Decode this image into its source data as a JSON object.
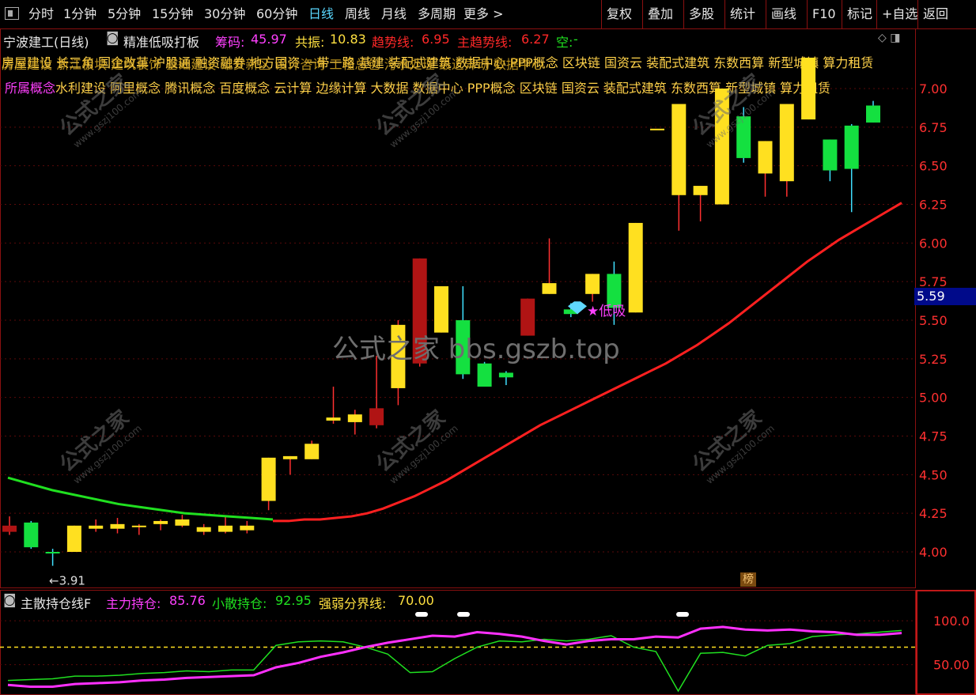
{
  "toolbar": {
    "periods": [
      "分时",
      "1分钟",
      "5分钟",
      "15分钟",
      "30分钟",
      "60分钟",
      "日线",
      "周线",
      "月线",
      "多周期",
      "更多 >"
    ],
    "active_period": "日线",
    "tools": [
      "复权",
      "叠加",
      "多股",
      "统计",
      "画线",
      "F10",
      "标记",
      "+自选",
      "返回"
    ]
  },
  "header": {
    "stock": "宁波建工(日线)",
    "indicator": "精准低吸打板",
    "chouma_label": "筹码:",
    "chouma_value": "45.97",
    "gongzhen_label": "共振:",
    "gongzhen_value": "10.83",
    "trend_label": "趋势线:",
    "trend_value": "6.95",
    "main_trend_label": "主趋势线:",
    "main_trend_value": "6.27",
    "kong_label": "空:",
    "kong_value": "-"
  },
  "concepts": {
    "label": "所属概念",
    "text": "水利建设 阿里概念 腾讯概念 百度概念 云计算 边缘计算 大数据 数据中心 PPP概念 区块链 国资云 装配式建筑 东数西算 新型城镇 算力租赁",
    "overlap_text": "房屋建设 长三角 国企改革 沪股通 融资融券 地方国资 一带一路 基建 装配式建筑 数据中心 PPP概念 区块链 国资云 装配式建筑 东数西算 新型城镇 算力租赁",
    "overlap_text2": "房屋建设 浙江板块 建筑装饰 基础建设 雄安新区 设计咨询 工程总包 污水处理 最近异动 数据中心"
  },
  "watermark": "公式之家 bbs.gszb.top",
  "watermark_small": "公式之家",
  "watermark_url": "www.gszj100.com",
  "price_tag": "5.59",
  "low_mark": "←3.91",
  "dixi_label": "低吸",
  "bang_label": "榜",
  "indicator_panel": {
    "title": "主散持仓线F",
    "main_label": "主力持仓:",
    "main_value": "85.76",
    "retail_label": "小散持仓:",
    "retail_value": "92.95",
    "boundary_label": "强弱分界线:",
    "boundary_value": "70.00",
    "y_ticks": [
      "100.0",
      "50.00"
    ]
  },
  "colors": {
    "up": "#ffe020",
    "up_dark": "#d4a000",
    "down": "#14e040",
    "down_red": "#b01414",
    "trend_red": "#ff2020",
    "trend_green": "#20e020",
    "magenta": "#ff30ff",
    "yellow": "#ffd24a",
    "grid": "#5a0a0a"
  },
  "chart_data": {
    "type": "candlestick",
    "ylim": [
      3.85,
      7.2
    ],
    "y_ticks": [
      "7.00",
      "6.75",
      "6.50",
      "6.25",
      "6.00",
      "5.75",
      "5.50",
      "5.25",
      "5.00",
      "4.75",
      "4.50",
      "4.25",
      "4.00"
    ],
    "candles": [
      {
        "o": 4.17,
        "h": 4.23,
        "l": 4.11,
        "c": 4.13,
        "dir": "down_red"
      },
      {
        "o": 4.19,
        "h": 4.2,
        "l": 4.02,
        "c": 4.03,
        "dir": "down"
      },
      {
        "o": 3.99,
        "h": 4.02,
        "l": 3.91,
        "c": 4.0,
        "dir": "down"
      },
      {
        "o": 4.0,
        "h": 4.17,
        "l": 4.0,
        "c": 4.17,
        "dir": "up"
      },
      {
        "o": 4.15,
        "h": 4.21,
        "l": 4.13,
        "c": 4.17,
        "dir": "up"
      },
      {
        "o": 4.15,
        "h": 4.22,
        "l": 4.12,
        "c": 4.18,
        "dir": "up"
      },
      {
        "o": 4.17,
        "h": 4.18,
        "l": 4.11,
        "c": 4.17,
        "dir": "up"
      },
      {
        "o": 4.18,
        "h": 4.21,
        "l": 4.14,
        "c": 4.2,
        "dir": "up"
      },
      {
        "o": 4.17,
        "h": 4.24,
        "l": 4.16,
        "c": 4.21,
        "dir": "up"
      },
      {
        "o": 4.13,
        "h": 4.18,
        "l": 4.11,
        "c": 4.16,
        "dir": "up"
      },
      {
        "o": 4.13,
        "h": 4.23,
        "l": 4.12,
        "c": 4.17,
        "dir": "up"
      },
      {
        "o": 4.14,
        "h": 4.2,
        "l": 4.12,
        "c": 4.17,
        "dir": "up"
      },
      {
        "o": 4.33,
        "h": 4.61,
        "l": 4.27,
        "c": 4.61,
        "dir": "up"
      },
      {
        "o": 4.6,
        "h": 4.62,
        "l": 4.5,
        "c": 4.62,
        "dir": "up"
      },
      {
        "o": 4.6,
        "h": 4.72,
        "l": 4.6,
        "c": 4.7,
        "dir": "up"
      },
      {
        "o": 4.85,
        "h": 5.07,
        "l": 4.83,
        "c": 4.87,
        "dir": "up"
      },
      {
        "o": 4.84,
        "h": 4.92,
        "l": 4.76,
        "c": 4.89,
        "dir": "up"
      },
      {
        "o": 4.93,
        "h": 5.27,
        "l": 4.8,
        "c": 4.82,
        "dir": "down_red"
      },
      {
        "o": 5.06,
        "h": 5.5,
        "l": 4.95,
        "c": 5.47,
        "dir": "up"
      },
      {
        "o": 5.9,
        "h": 5.9,
        "l": 5.2,
        "c": 5.22,
        "dir": "down_red"
      },
      {
        "o": 5.42,
        "h": 5.72,
        "l": 5.42,
        "c": 5.72,
        "dir": "up"
      },
      {
        "o": 5.5,
        "h": 5.72,
        "l": 5.12,
        "c": 5.15,
        "dir": "down"
      },
      {
        "o": 5.22,
        "h": 5.23,
        "l": 5.07,
        "c": 5.07,
        "dir": "down"
      },
      {
        "o": 5.16,
        "h": 5.17,
        "l": 5.08,
        "c": 5.13,
        "dir": "down"
      },
      {
        "o": 5.4,
        "h": 5.64,
        "l": 5.4,
        "c": 5.64,
        "dir": "down_red"
      },
      {
        "o": 5.67,
        "h": 6.03,
        "l": 5.67,
        "c": 5.74,
        "dir": "up"
      },
      {
        "o": 5.54,
        "h": 5.61,
        "l": 5.52,
        "c": 5.57,
        "dir": "down"
      },
      {
        "o": 5.67,
        "h": 5.8,
        "l": 5.62,
        "c": 5.8,
        "dir": "up"
      },
      {
        "o": 5.8,
        "h": 5.88,
        "l": 5.47,
        "c": 5.58,
        "dir": "down"
      },
      {
        "o": 5.55,
        "h": 6.13,
        "l": 5.55,
        "c": 6.13,
        "dir": "up"
      },
      {
        "o": 6.74,
        "h": 6.74,
        "l": 6.74,
        "c": 6.74,
        "dir": "up"
      },
      {
        "o": 6.31,
        "h": 6.9,
        "l": 6.08,
        "c": 6.9,
        "dir": "up"
      },
      {
        "o": 6.31,
        "h": 6.37,
        "l": 6.14,
        "c": 6.37,
        "dir": "up"
      },
      {
        "o": 6.25,
        "h": 7.0,
        "l": 6.25,
        "c": 7.0,
        "dir": "up"
      },
      {
        "o": 6.82,
        "h": 6.88,
        "l": 6.52,
        "c": 6.55,
        "dir": "down"
      },
      {
        "o": 6.45,
        "h": 6.66,
        "l": 6.3,
        "c": 6.66,
        "dir": "up"
      },
      {
        "o": 6.4,
        "h": 6.9,
        "l": 6.3,
        "c": 6.9,
        "dir": "up"
      },
      {
        "o": 6.8,
        "h": 7.2,
        "l": 6.8,
        "c": 7.2,
        "dir": "up"
      },
      {
        "o": 6.67,
        "h": 6.67,
        "l": 6.4,
        "c": 6.47,
        "dir": "down"
      },
      {
        "o": 6.48,
        "h": 6.77,
        "l": 6.2,
        "c": 6.76,
        "dir": "down"
      },
      {
        "o": 6.78,
        "h": 6.92,
        "l": 6.78,
        "c": 6.89,
        "dir": "down"
      }
    ],
    "trend_red": [
      4.2,
      4.2,
      4.21,
      4.21,
      4.22,
      4.23,
      4.25,
      4.28,
      4.32,
      4.36,
      4.41,
      4.46,
      4.52,
      4.58,
      4.64,
      4.7,
      4.76,
      4.82,
      4.87,
      4.92,
      4.97,
      5.02,
      5.07,
      5.12,
      5.17,
      5.22,
      5.28,
      5.34,
      5.41,
      5.48,
      5.56,
      5.64,
      5.72,
      5.8,
      5.88,
      5.95,
      6.02,
      6.08,
      6.14,
      6.2,
      6.26
    ],
    "trend_green": [
      4.48,
      4.44,
      4.4,
      4.37,
      4.34,
      4.31,
      4.29,
      4.27,
      4.25,
      4.24,
      4.23,
      4.22,
      4.21
    ],
    "ind_main": [
      27,
      25,
      25,
      28,
      29,
      30,
      32,
      33,
      35,
      36,
      37,
      38,
      47,
      52,
      59,
      64,
      70,
      75,
      79,
      83,
      82,
      87,
      85,
      82,
      77,
      73,
      77,
      79,
      79,
      82,
      81,
      91,
      93,
      90,
      89,
      90,
      88,
      87,
      84,
      84,
      86
    ],
    "ind_retail": [
      32,
      33,
      34,
      37,
      37,
      38,
      40,
      41,
      43,
      42,
      44,
      44,
      72,
      76,
      77,
      76,
      70,
      62,
      41,
      42,
      57,
      70,
      77,
      76,
      79,
      77,
      79,
      83,
      70,
      65,
      20,
      63,
      64,
      60,
      72,
      74,
      82,
      84,
      85,
      87,
      89
    ],
    "ind_boundary": 70,
    "ind_ylim": [
      20,
      110
    ],
    "ind_markers_x_idx": [
      20,
      22,
      33
    ]
  }
}
